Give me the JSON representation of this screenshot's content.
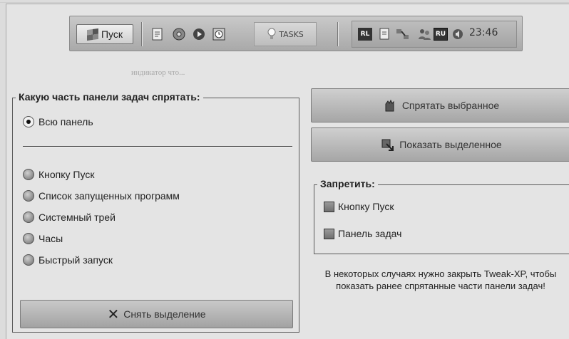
{
  "taskbar": {
    "start_label": "Пуск",
    "task_label": "TASKS",
    "clock": "23:46",
    "lang_indicator": "RU",
    "quick_icons": [
      "doc-icon",
      "disc-icon",
      "media-icon",
      "clock-icon"
    ],
    "tray_icons": [
      "rl-icon",
      "doc-icon",
      "network-icon",
      "users-icon",
      "ru-icon",
      "volume-icon"
    ]
  },
  "background_hint": "индикатор что...",
  "hide_group": {
    "title": "Какую часть панели задач спрятать:",
    "whole_panel": "Всю панель",
    "options": [
      "Кнопку Пуск",
      "Список запущенных программ",
      "Системный трей",
      "Часы",
      "Быстрый запуск"
    ],
    "clear_button": "Снять выделение"
  },
  "actions": {
    "hide_selected": "Спрятать выбранное",
    "show_selected": "Показать выделенное"
  },
  "forbid_group": {
    "title": "Запретить:",
    "items": [
      "Кнопку Пуск",
      "Панель задач"
    ]
  },
  "note": "В некоторых случаях нужно закрыть Tweak-XP, чтобы показать ранее спрятанные части панели задач!",
  "colors": {
    "background": "#e4e4e4",
    "button": "#b8b8b8",
    "text": "#222222"
  }
}
